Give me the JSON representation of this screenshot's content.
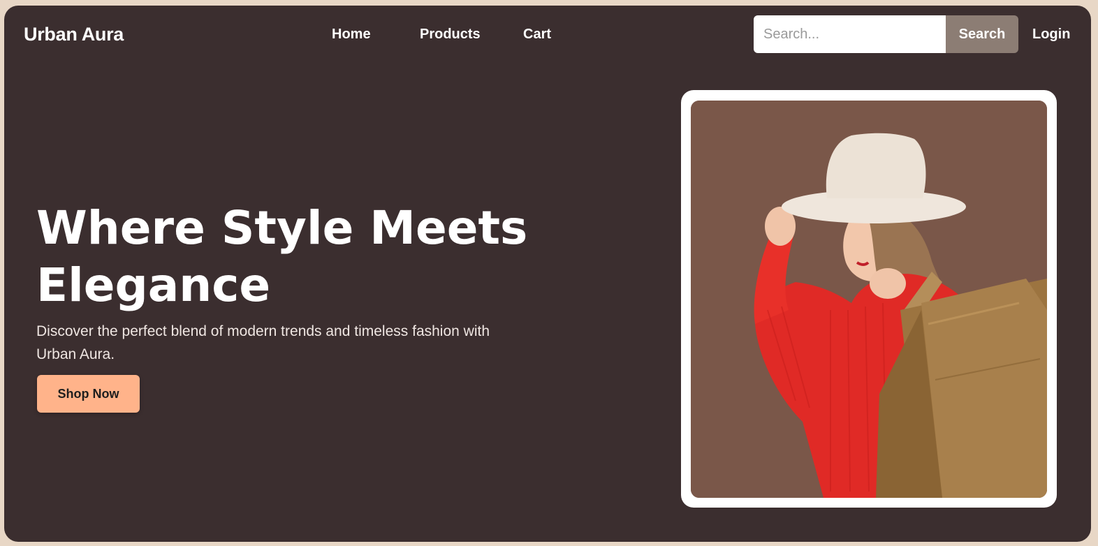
{
  "brand": {
    "name": "Urban Aura"
  },
  "nav": {
    "home": "Home",
    "products": "Products",
    "cart": "Cart"
  },
  "search": {
    "placeholder": "Search...",
    "value": "",
    "button_label": "Search"
  },
  "login_label": "Login",
  "hero": {
    "title": "Where Style Meets Elegance",
    "description": "Discover the perfect blend of modern trends and timeless fashion with Urban Aura.",
    "cta_label": "Shop Now"
  },
  "colors": {
    "page_bg": "#e8d7c6",
    "frame_bg": "#3b2e2f",
    "search_button": "#8c7d74",
    "cta": "#ffb38a",
    "photo_bg": "#7a5749"
  },
  "hero_image": {
    "icon": "woman-with-shopping-bags-photo"
  }
}
